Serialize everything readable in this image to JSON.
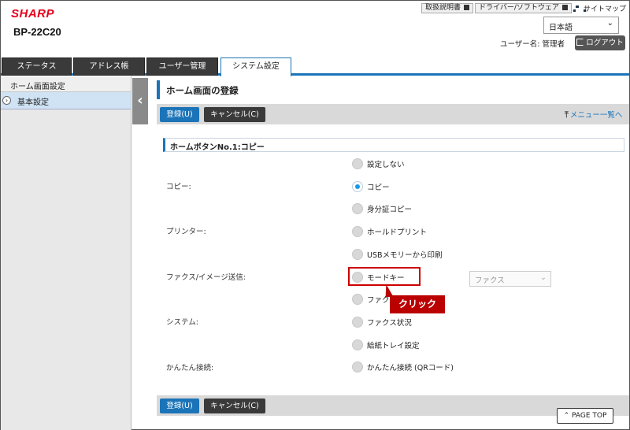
{
  "header": {
    "logo": "SHARP",
    "model": "BP-22C20",
    "links": {
      "manual": "取扱説明書",
      "driver": "ドライバー/ソフトウェア",
      "sitemap": "サイトマップ"
    },
    "language": "日本語",
    "user_label": "ユーザー名: 管理者",
    "logout": "ログアウト"
  },
  "tabs": [
    "ステータス",
    "アドレス帳",
    "ユーザー管理",
    "システム設定"
  ],
  "active_tab": "システム設定",
  "sidebar": {
    "title": "ホーム画面設定",
    "items": [
      {
        "label": "基本設定",
        "icon": "chevron-right-icon"
      }
    ]
  },
  "main": {
    "page_title": "ホーム画面の登録",
    "register_label": "登録(U)",
    "cancel_label": "キャンセル(C)",
    "menu_back": "メニュー一覧へ",
    "section_title": "ホームボタンNo.1:コピー",
    "row_labels": [
      "コピー:",
      "プリンター:",
      "ファクス/イメージ送信:",
      "システム:",
      "かんたん接続:"
    ],
    "options": [
      "設定しない",
      "コピー",
      "身分証コピー",
      "ホールドプリント",
      "USBメモリーから印刷",
      "モードキー",
      "ファク",
      "ファクス状況",
      "給紙トレイ設定",
      "かんたん接続 (QRコード)"
    ],
    "selected_option": "コピー",
    "fax_select_value": "ファクス",
    "callout": "クリック",
    "page_top": "PAGE TOP"
  },
  "colors": {
    "accent": "#1b74b8",
    "brand": "#e4001b",
    "callout": "#b00000"
  }
}
